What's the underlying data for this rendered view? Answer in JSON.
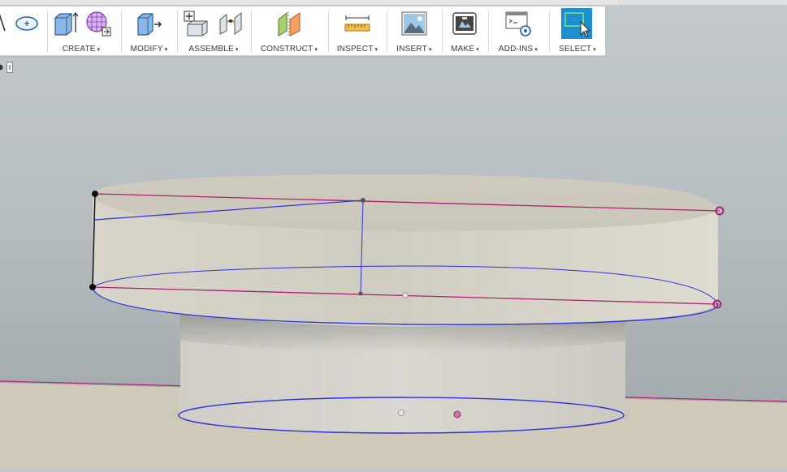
{
  "toolbar": {
    "groups": [
      {
        "id": "create",
        "label": "CREATE"
      },
      {
        "id": "modify",
        "label": "MODIFY"
      },
      {
        "id": "assemble",
        "label": "ASSEMBLE"
      },
      {
        "id": "construct",
        "label": "CONSTRUCT"
      },
      {
        "id": "inspect",
        "label": "INSPECT"
      },
      {
        "id": "insert",
        "label": "INSERT"
      },
      {
        "id": "make",
        "label": "MAKE"
      },
      {
        "id": "addins",
        "label": "ADD-INS"
      },
      {
        "id": "select",
        "label": "SELECT"
      }
    ],
    "caret": "▾"
  },
  "icons": {
    "create": [
      "extrude-box-icon",
      "form-grid-icon"
    ],
    "modify": [
      "press-pull-icon"
    ],
    "assemble": [
      "new-component-icon",
      "joint-icon"
    ],
    "construct": [
      "offset-plane-icon"
    ],
    "inspect": [
      "measure-ruler-icon"
    ],
    "insert": [
      "insert-image-icon"
    ],
    "make": [
      "print-3d-icon"
    ],
    "addins": [
      "scripts-addins-icon"
    ],
    "select": [
      "window-select-icon"
    ]
  },
  "colors": {
    "select_active": "#1b8fd0",
    "sketch_line_blue": "#3030e0",
    "constraint_line_magenta": "#b0206f",
    "model_body": "#d5d2c7",
    "ground_plane": "#cfcab9"
  }
}
